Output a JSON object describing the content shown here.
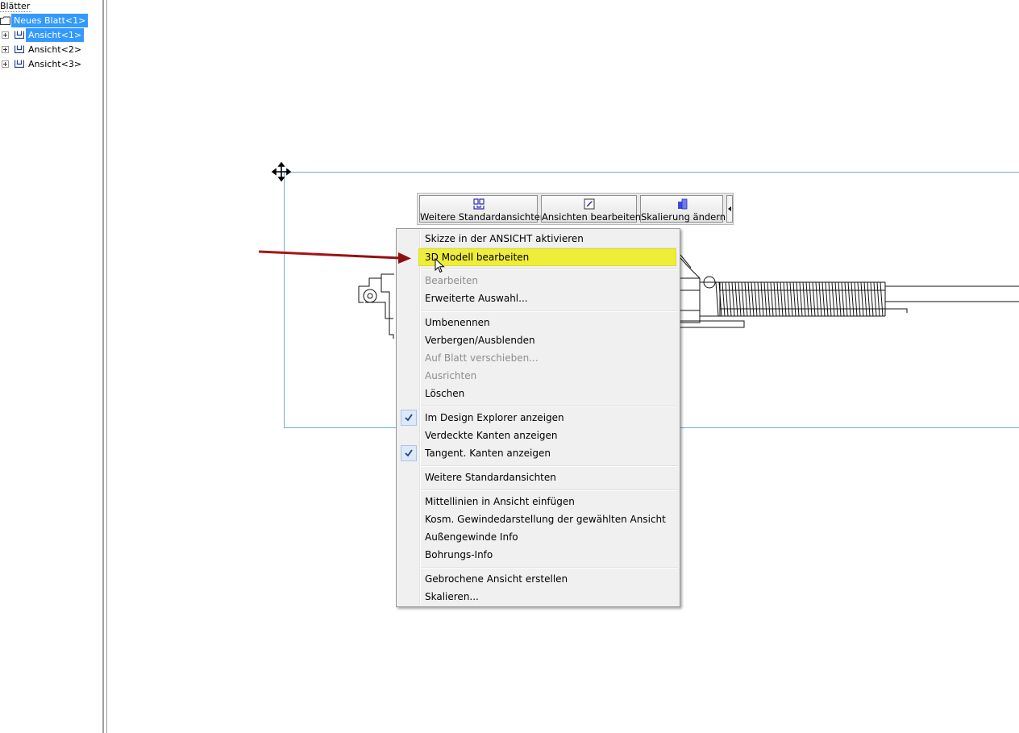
{
  "tree": {
    "title": "Blätter",
    "sheet": {
      "label": "Neues Blatt<1>"
    },
    "views": [
      {
        "label": "Ansicht<1>",
        "selected": true
      },
      {
        "label": "Ansicht<2>",
        "selected": false
      },
      {
        "label": "Ansicht<3>",
        "selected": false
      }
    ]
  },
  "toolbar": {
    "buttons": [
      {
        "label": "Weitere Standardansichten",
        "icon": "standard-views-icon"
      },
      {
        "label": "Ansichten bearbeiten",
        "icon": "edit-views-icon"
      },
      {
        "label": "Skalierung ändern",
        "icon": "scale-icon"
      }
    ]
  },
  "menu": {
    "items": [
      {
        "label": "Skizze in der ANSICHT aktivieren"
      },
      {
        "label": "3D Modell bearbeiten",
        "highlighted": true
      },
      {
        "label": "Bearbeiten",
        "disabled": true
      },
      {
        "label": "Erweiterte Auswahl..."
      },
      {
        "label": "Umbenennen"
      },
      {
        "label": "Verbergen/Ausblenden"
      },
      {
        "label": "Auf Blatt verschieben...",
        "disabled": true
      },
      {
        "label": "Ausrichten",
        "disabled": true
      },
      {
        "label": "Löschen"
      },
      {
        "label": "Im Design Explorer anzeigen",
        "checked": true
      },
      {
        "label": "Verdeckte Kanten anzeigen"
      },
      {
        "label": "Tangent. Kanten anzeigen",
        "checked": true
      },
      {
        "label": "Weitere Standardansichten"
      },
      {
        "label": "Mittellinien in Ansicht einfügen"
      },
      {
        "label": "Kosm. Gewindedarstellung der gewählten Ansicht"
      },
      {
        "label": "Außengewinde Info"
      },
      {
        "label": "Bohrungs-Info"
      },
      {
        "label": "Gebrochene Ansicht erstellen"
      },
      {
        "label": "Skalieren..."
      }
    ]
  },
  "colors": {
    "selection": "#3399ff",
    "highlight": "#eded3a",
    "view_frame": "#6aaedc",
    "annotation_arrow": "#b01515"
  }
}
